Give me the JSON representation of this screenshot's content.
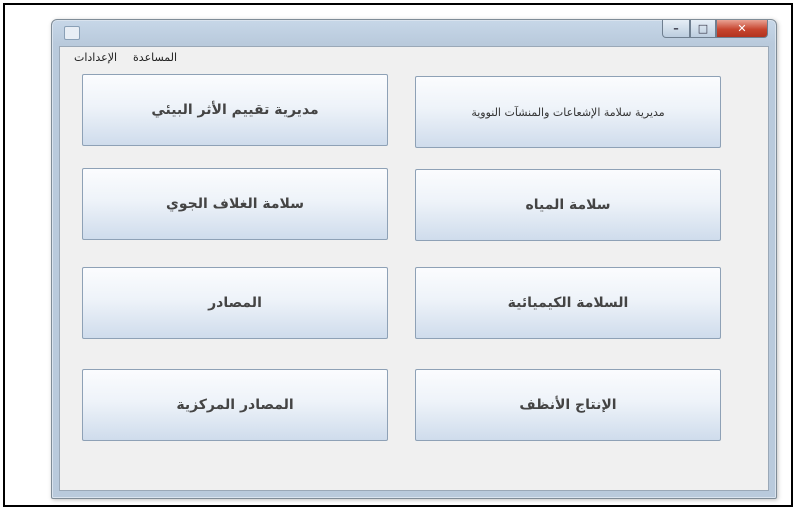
{
  "window": {
    "menu": [
      "الإعدادات",
      "المساعدة"
    ]
  },
  "tiles": [
    {
      "label": "مديرية سلامة الإشعاعات والمنشآت النووية"
    },
    {
      "label": "مديرية تقييم الأثر البيئي"
    },
    {
      "label": "سلامة المياه"
    },
    {
      "label": "سلامة الغلاف الجوي"
    },
    {
      "label": "السلامة الكيميائية"
    },
    {
      "label": "المصادر"
    },
    {
      "label": "الإنتاج الأنظف"
    },
    {
      "label": "المصادر المركزية"
    }
  ]
}
